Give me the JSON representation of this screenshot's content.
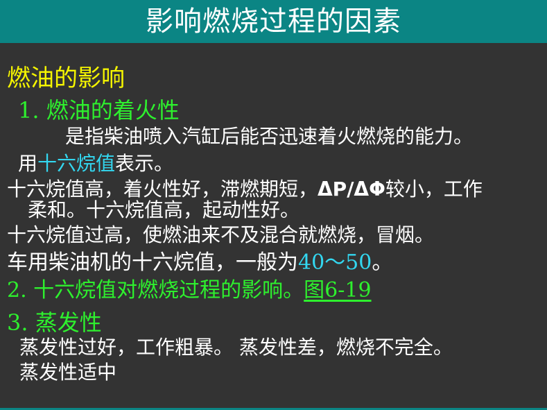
{
  "slide": {
    "title": "影响燃烧过程的因素",
    "colors": {
      "title_bar": "#0b8584",
      "background": "#333333",
      "text": "#ffffff",
      "heading": "#f5f500",
      "subheading": "#2ef02e",
      "highlight": "#33d7f0"
    },
    "heading": "燃油的影响",
    "section1": {
      "heading": "1. 燃油的着火性",
      "definition": "是指柴油喷入汽缸后能否迅速着火燃烧的能力。",
      "usage_prefix": "用",
      "usage_term": "十六烷值",
      "usage_suffix": "表示。",
      "effect_line1_prefix": "十六烷值高，着火性好，滞燃期短，",
      "effect_line1_symbol": "ΔP/ΔΦ",
      "effect_line1_suffix": "较小，工作",
      "effect_line2": "柔和。十六烷值高，起动性好。",
      "excess": "十六烷值过高，使燃油来不及混合就燃烧，冒烟。",
      "typical_prefix": "车用柴油机的十六烷值，一般为",
      "typical_range": "40～50",
      "typical_suffix": "。"
    },
    "section2": {
      "heading": "2. 十六烷值对燃烧过程的影响。",
      "figure_link": "图6-19"
    },
    "section3": {
      "heading": "3.  蒸发性",
      "line1": "蒸发性过好，工作粗暴。 蒸发性差，燃烧不完全。",
      "line2": "蒸发性适中"
    }
  }
}
